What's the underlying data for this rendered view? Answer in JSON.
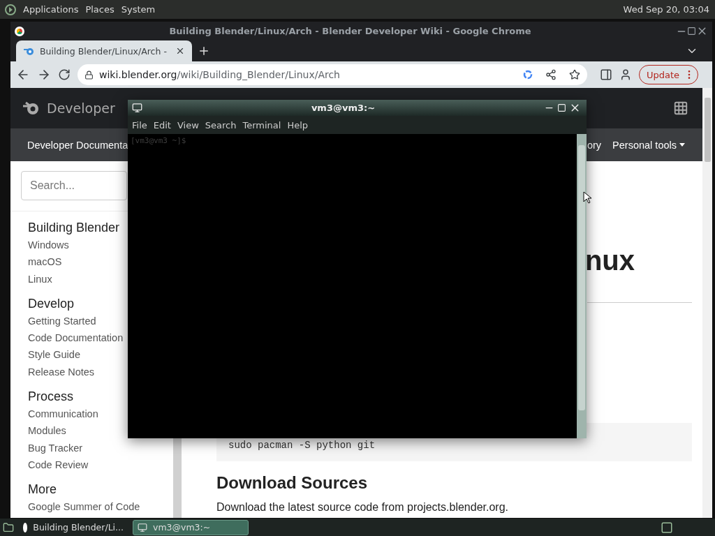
{
  "top_panel": {
    "menus": [
      "Applications",
      "Places",
      "System"
    ],
    "clock": "Wed Sep 20, 03:04"
  },
  "browser": {
    "window_title": "Building Blender/Linux/Arch - Blender Developer Wiki - Google Chrome",
    "tabs": [
      {
        "label": "Building Blender/Linux/Arch -",
        "selected": true
      }
    ],
    "address": {
      "host": "wiki.blender.org",
      "path": "/wiki/Building_Blender/Linux/Arch"
    },
    "update_button": "Update",
    "page": {
      "site_name": "Developer",
      "nav": [
        {
          "label": "Developer Documenta",
          "dropdown": false
        },
        {
          "label": "ory",
          "dropdown": false
        },
        {
          "label": "Personal tools",
          "dropdown": true
        }
      ],
      "search": {
        "placeholder": "Search..."
      },
      "sidebar": [
        {
          "heading": "Building Blender",
          "items": [
            "Windows",
            "macOS",
            "Linux"
          ]
        },
        {
          "heading": "Develop",
          "items": [
            "Getting Started",
            "Code Documentation",
            "Style Guide",
            "Release Notes"
          ]
        },
        {
          "heading": "Process",
          "items": [
            "Communication",
            "Modules",
            "Bug Tracker",
            "Code Review"
          ]
        },
        {
          "heading": "More",
          "items": [
            "Google Summer of Code"
          ]
        }
      ],
      "heading": "nux",
      "code": "sudo pacman -S python git",
      "section_title": "Download Sources",
      "paragraph": "Download the latest source code from projects.blender.org."
    }
  },
  "terminal": {
    "title": "vm3@vm3:~",
    "menus": [
      "File",
      "Edit",
      "View",
      "Search",
      "Terminal",
      "Help"
    ],
    "prompt": "[vm3@vm3 ~]$"
  },
  "taskbar": {
    "items": [
      {
        "label": "Building Blender/Li...",
        "kind": "browser",
        "selected": false
      },
      {
        "label": "vm3@vm3:~",
        "kind": "terminal",
        "selected": true
      }
    ]
  }
}
